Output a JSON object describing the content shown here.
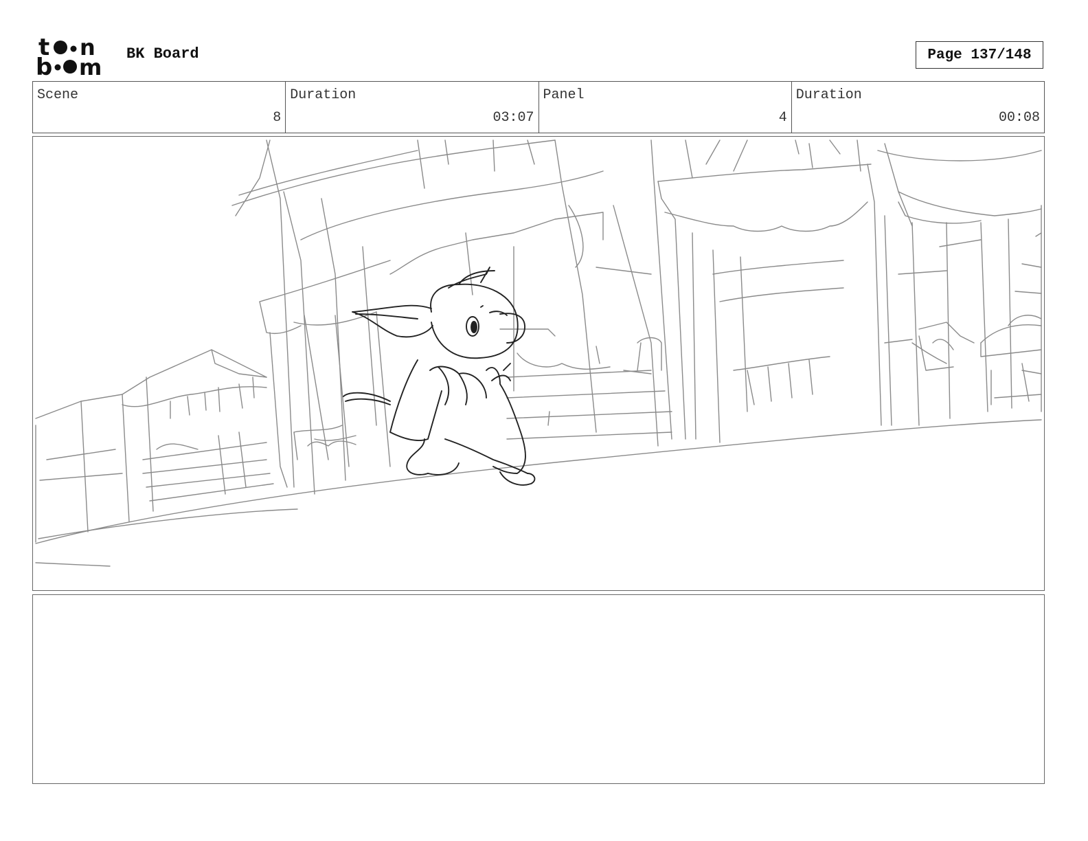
{
  "header": {
    "logo_text": "toon boom",
    "board_title": "BK Board",
    "page_label": "Page 137/148"
  },
  "info": {
    "scene_label": "Scene",
    "scene_value": "8",
    "duration_label": "Duration",
    "duration_value": "03:07",
    "panel_label": "Panel",
    "panel_value": "4",
    "panel_duration_label": "Duration",
    "panel_duration_value": "00:08"
  },
  "panel": {
    "image_subject": "rough pencil sketch of a small hooded creature with a backpack running through a market street"
  },
  "notes": {
    "text": ""
  }
}
